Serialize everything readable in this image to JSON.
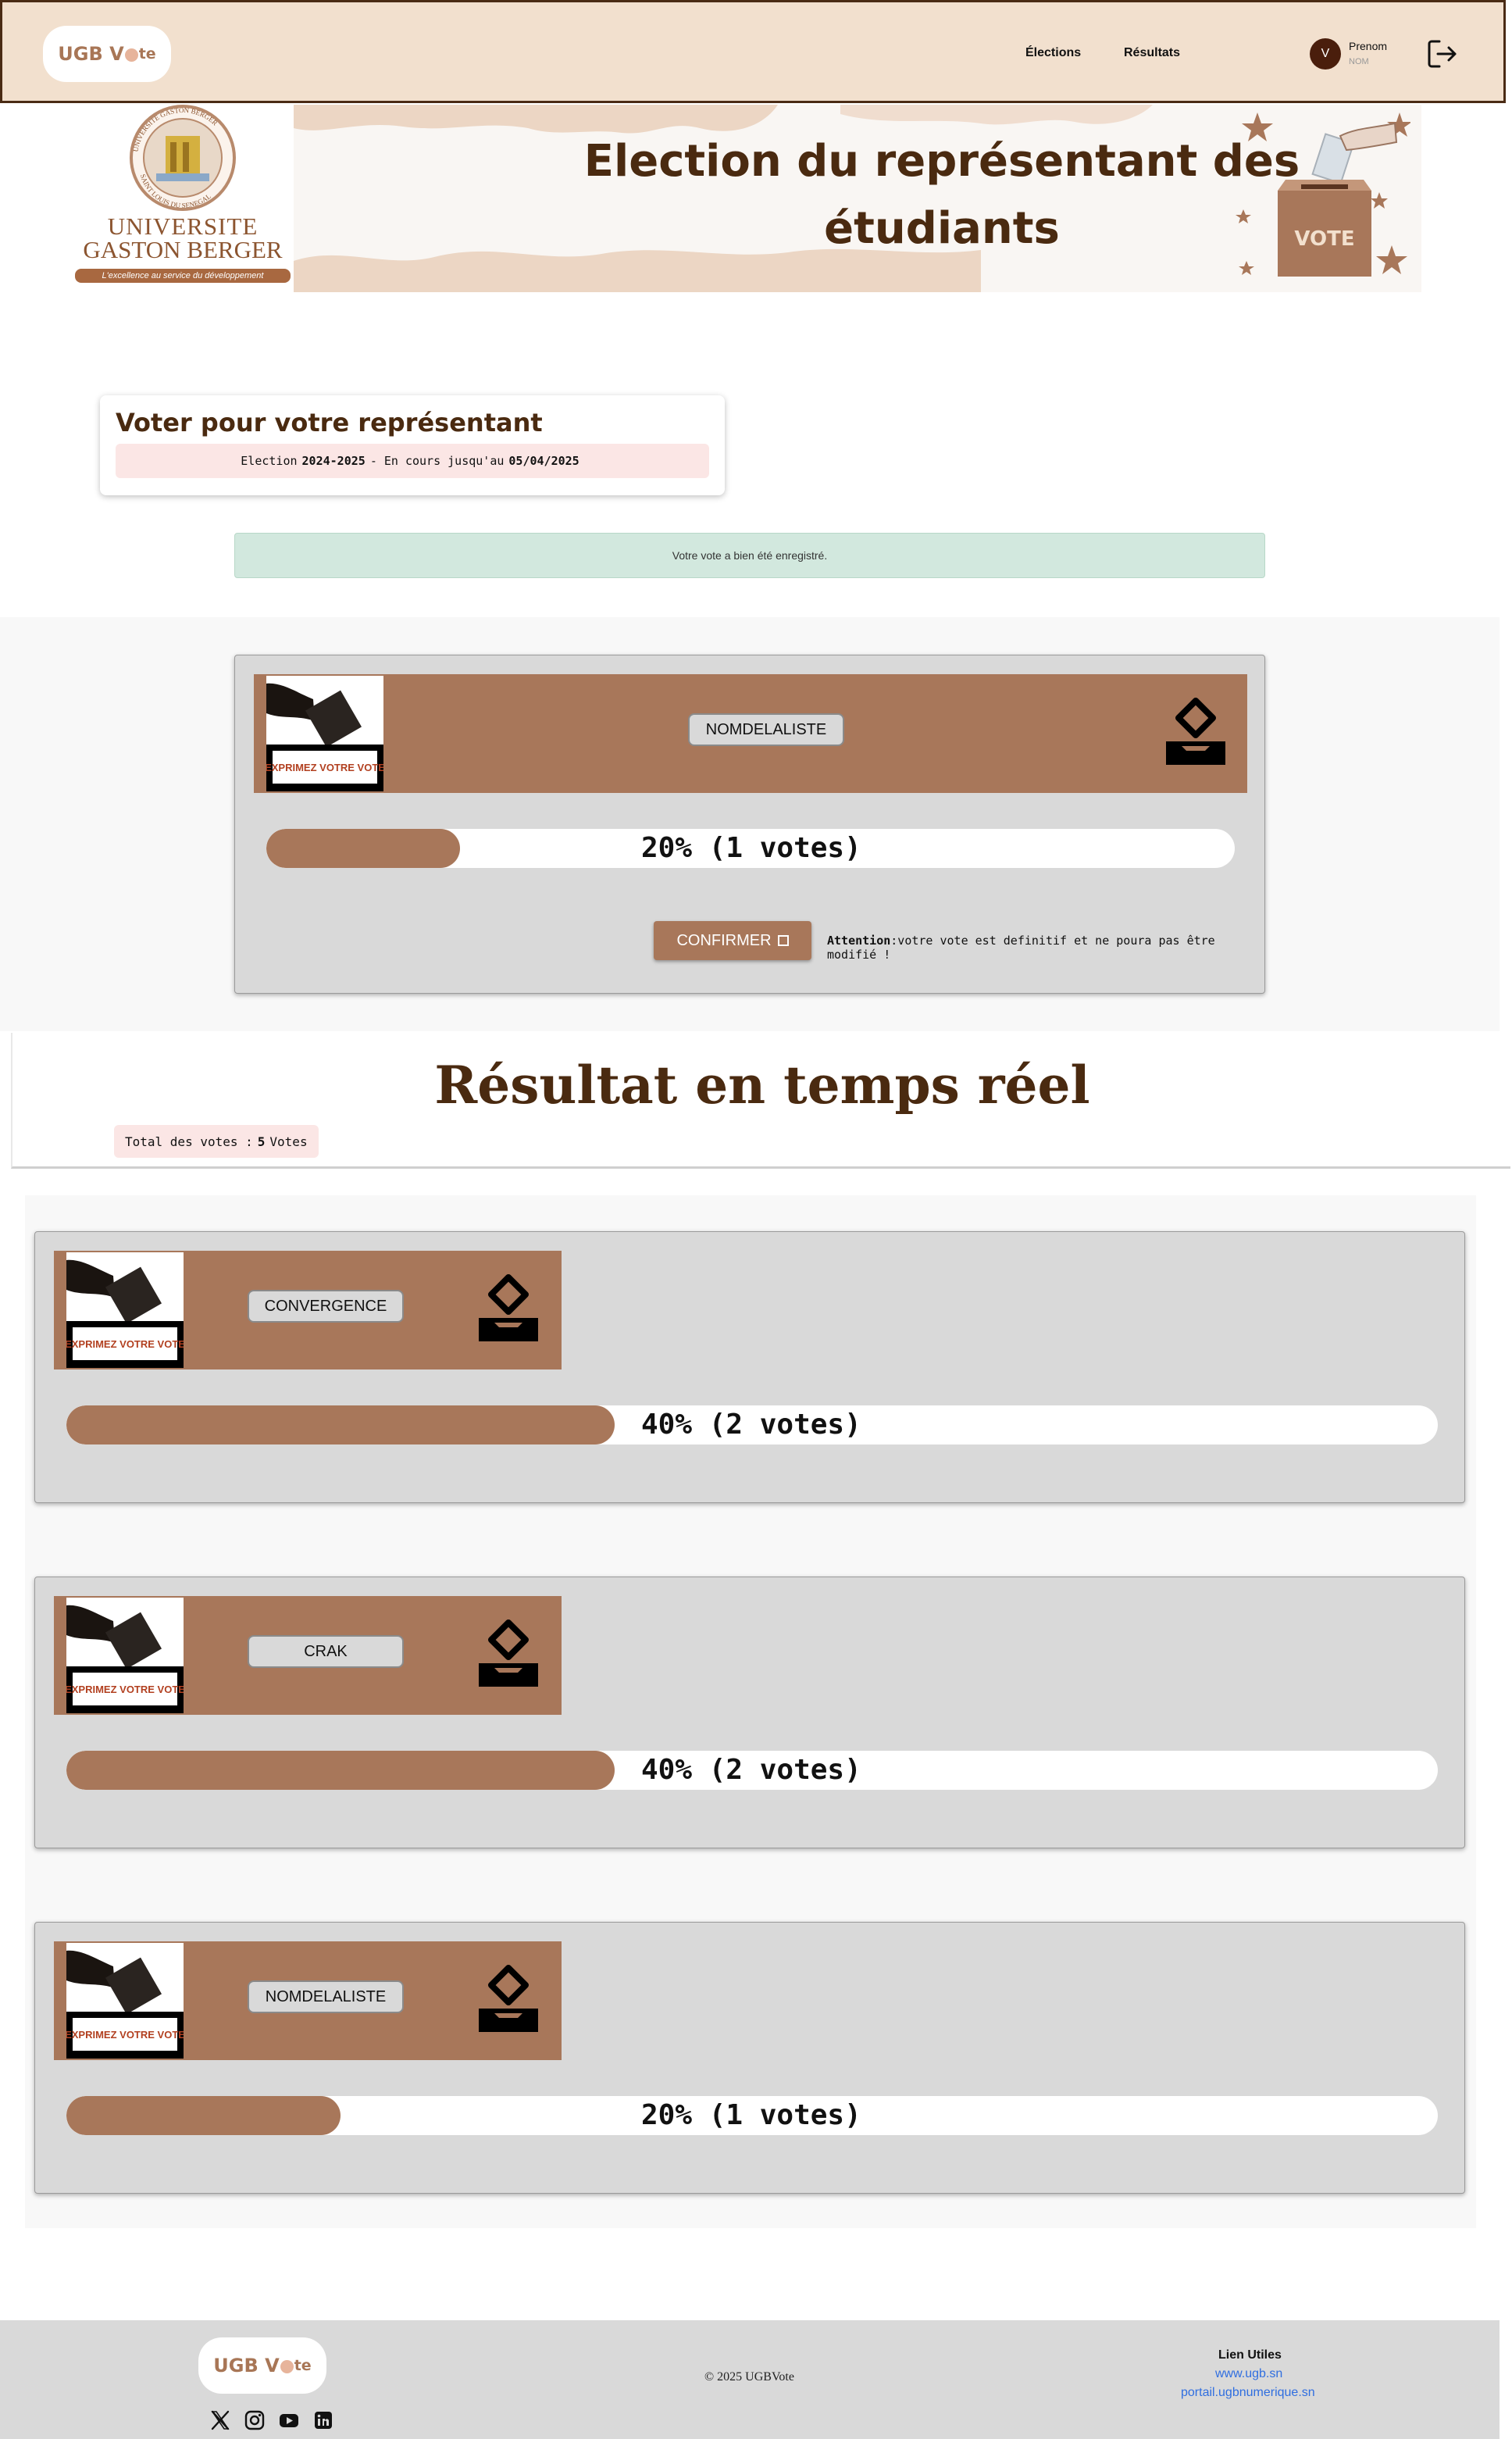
{
  "header": {
    "brand": {
      "part1": "UGB V",
      "part2": "te"
    },
    "nav": [
      "Élections",
      "Résultats"
    ],
    "user": {
      "initial": "V",
      "first_name": "Prenom",
      "last_name": "NOM"
    }
  },
  "banner": {
    "title_line1": "Election du représentant des",
    "title_line2": "étudiants",
    "logo": {
      "text1": "UNIVERSITE",
      "text2": "GASTON BERGER",
      "slogan": "L'excellence au service du développement",
      "ring_top": "UNIVERSITE GASTON BERGER",
      "ring_bottom": "SAINT LOUIS DU SENEGAL"
    },
    "box_label": "VOTE"
  },
  "vote_card": {
    "title": "Voter pour votre représentant",
    "subtitle_prefix": "Election",
    "year": "2024-2025",
    "subtitle_mid": "- En cours jusqu'au",
    "end_date": "05/04/2025"
  },
  "alert": "Votre vote a bien été enregistré.",
  "candidate_image_text": "EXPRIMEZ VOTRE VOTE",
  "vote": {
    "candidate": "NOMDELALISTE",
    "percent": 20,
    "label": "20% (1 votes)",
    "confirm_label": "CONFIRMER",
    "warning_bold": "Attention",
    "warning_text": ":votre vote est definitif et ne poura pas être modifié !"
  },
  "results": {
    "title": "Résultat en temps réel",
    "total_prefix": "Total des votes :",
    "total_value": "5",
    "total_suffix": "Votes",
    "items": [
      {
        "name": "CONVERGENCE",
        "percent": 40,
        "label": "40% (2 votes)"
      },
      {
        "name": "CRAK",
        "percent": 40,
        "label": "40% (2 votes)"
      },
      {
        "name": "NOMDELALISTE",
        "percent": 20,
        "label": "20% (1 votes)"
      }
    ]
  },
  "footer": {
    "brand": {
      "part1": "UGB V",
      "part2": "te"
    },
    "copyright": "© 2025 UGBVote",
    "links_title": "Lien Utiles",
    "links": [
      "www.ugb.sn",
      "portail.ugbnumerique.sn"
    ],
    "social": [
      "x-icon",
      "instagram-icon",
      "youtube-icon",
      "linkedin-icon"
    ]
  },
  "colors": {
    "accent": "#a8775a",
    "dark_brown": "#4a2a10",
    "header_bg": "#f2e0ce",
    "success_bg": "#d2e8de",
    "pill_bg": "#fbe6e5",
    "link": "#2f6ee0"
  }
}
